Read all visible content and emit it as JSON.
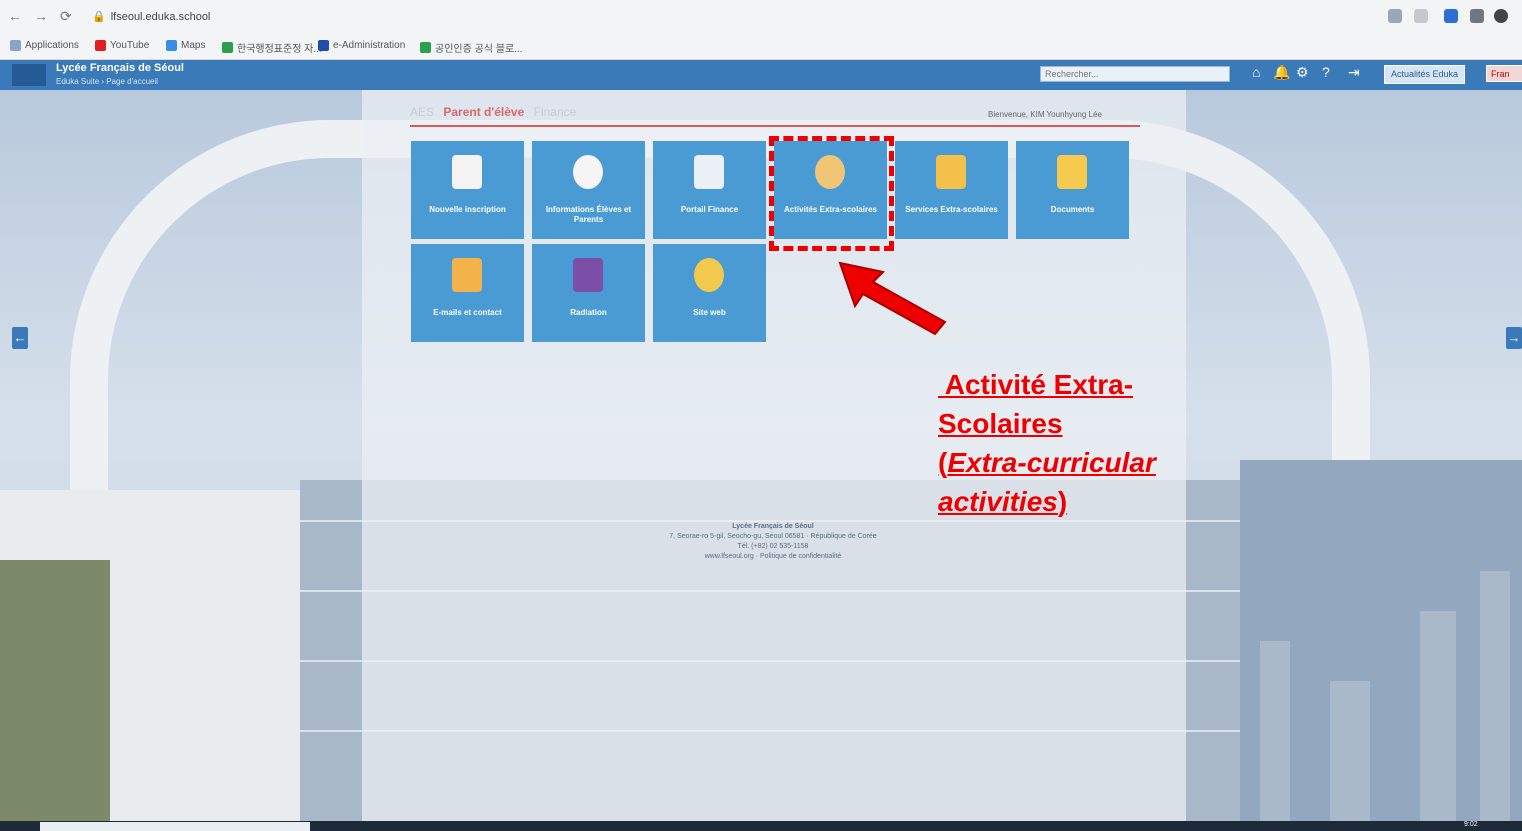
{
  "browser": {
    "url": "lfseoul.eduka.school",
    "bookmarks": [
      {
        "label": "Applications",
        "color": "#8aa4c7"
      },
      {
        "label": "YouTube",
        "color": "#e02020"
      },
      {
        "label": "Maps",
        "color": "#3a8ee8"
      },
      {
        "label": "한국행정표준정 자...",
        "color": "#2aa04a"
      },
      {
        "label": "e-Administration",
        "color": "#1f4ea8"
      },
      {
        "label": "공인인증 공식 블로...",
        "color": "#2aa04a"
      }
    ]
  },
  "header": {
    "title": "Lycée Français de Séoul",
    "breadcrumb": "Eduka Suite › Page d'accueil",
    "search_placeholder": "Rechercher...",
    "actualites_label": "Actualités Eduka",
    "lang_label": "Fran"
  },
  "tabs": {
    "aes": "AES",
    "parent": "Parent d'élève",
    "finance": "Finance"
  },
  "welcome": "Bienvenue, KIM Younhyung Lée",
  "tiles": [
    {
      "label": "Nouvelle inscription",
      "icon": "clipboard-icon",
      "color": "#f3f3f3"
    },
    {
      "label": "Informations Élèves et Parents",
      "icon": "people-icon",
      "color": "#f5f5f5"
    },
    {
      "label": "Portail Finance",
      "icon": "calculator-icon",
      "color": "#eaf0f6"
    },
    {
      "label": "Activités Extra-scolaires",
      "icon": "palette-icon",
      "color": "#f0c674"
    },
    {
      "label": "Services Extra-scolaires",
      "icon": "school-icon",
      "color": "#f4c04a"
    },
    {
      "label": "Documents",
      "icon": "folder-icon",
      "color": "#f6c94f"
    },
    {
      "label": "E-mails et contact",
      "icon": "envelope-icon",
      "color": "#f4b24a"
    },
    {
      "label": "Radiation",
      "icon": "door-exit-icon",
      "color": "#7b4fa8"
    },
    {
      "label": "Site web",
      "icon": "magnifier-icon",
      "color": "#f2c94c"
    }
  ],
  "annotation": {
    "line1": " Activité Extra-",
    "line2": "Scolaires",
    "line3_open": "(",
    "line3_italic": "Extra-curricular",
    "line4_italic": "activities",
    "line4_close": ")"
  },
  "footer": {
    "line1": "Lycée Français de Séoul",
    "line2": "7, Seorae-ro 5-gil, Seocho-gu, Séoul 06581 · République de Corée",
    "line3": "Tél. (+82) 02 535-1158",
    "line4": "www.lfseoul.org · Politique de confidentialité"
  },
  "taskbar": {
    "time": "9:02"
  }
}
